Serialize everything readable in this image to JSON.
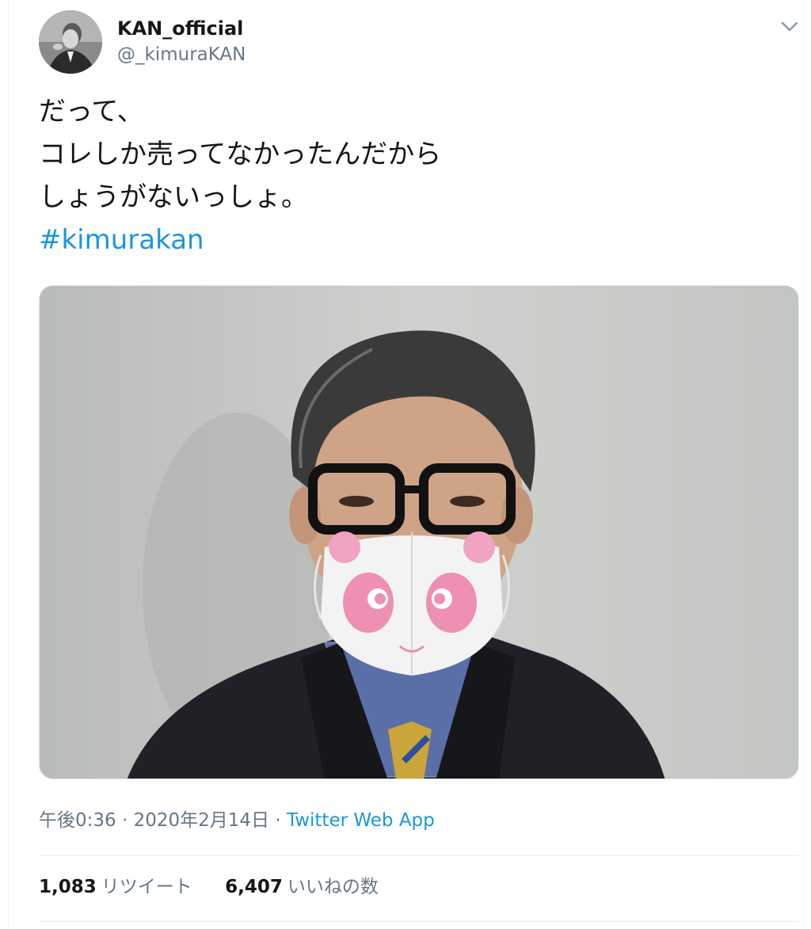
{
  "user": {
    "display_name": "KAN_official",
    "handle": "@_kimuraKAN"
  },
  "tweet": {
    "lines": [
      "だって、",
      "コレしか売ってなかったんだから",
      "しょうがないっしょ。"
    ],
    "hashtag": "#kimurakan"
  },
  "meta": {
    "time": "午後0:36",
    "sep1": " · ",
    "date": "2020年2月14日",
    "sep2": " · ",
    "app": "Twitter Web App"
  },
  "stats": {
    "retweets_count": "1,083",
    "retweets_label": "リツイート",
    "likes_count": "6,407",
    "likes_label": "いいねの数"
  },
  "icons": {
    "more": "chevron-down-icon"
  },
  "colors": {
    "link": "#1b95e0",
    "secondary_text": "#657786",
    "primary_text": "#14171a"
  }
}
